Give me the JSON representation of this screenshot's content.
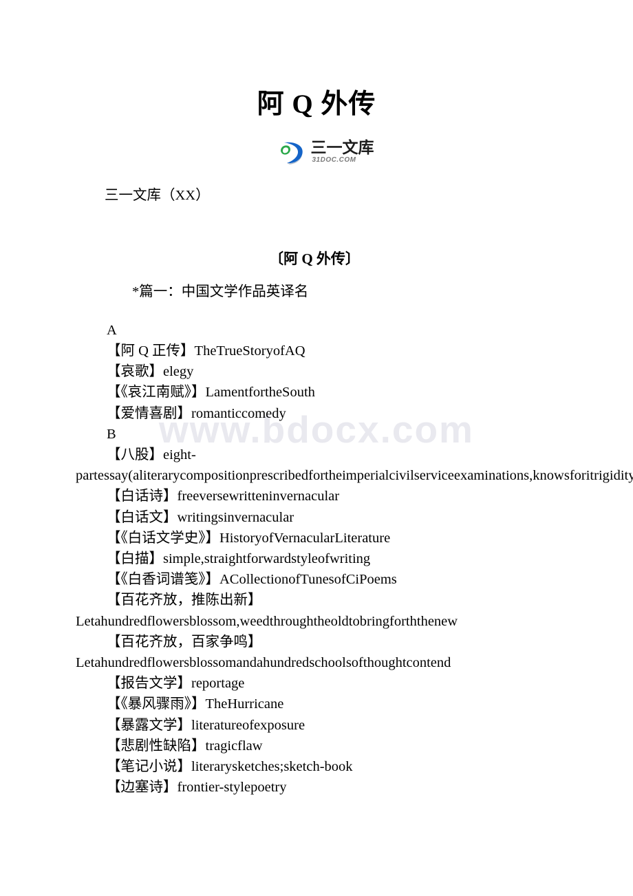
{
  "document": {
    "title": "阿 Q 外传",
    "watermark": "www.bdocx.com",
    "logo": {
      "cn_text": "三一文库",
      "en_text": "31DOC.COM",
      "mark_name": "sanyi-wenku-logo",
      "blue": "#1464c8",
      "blue_dark": "#0d3f96",
      "green": "#2aa84a"
    },
    "site_line": "三一文库（XX）",
    "section_title": "〔阿 Q 外传〕",
    "sub_title": "*篇一：中国文学作品英译名",
    "entries": [
      "A",
      "【阿 Q 正传】TheTrueStoryofAQ",
      "【哀歌】elegy",
      "【《哀江南赋》】LamentfortheSouth",
      "【爱情喜剧】romanticcomedy",
      "B",
      "【八股】eight-partessay(aliterarycompositionprescribedfortheimperialcivilserviceexaminations,knowsforitrigidityofformandpovertyofideas)",
      "【白话诗】freeversewritteninvernacular",
      "【白话文】writingsinvernacular",
      "【《白话文学史》】HistoryofVernacularLiterature",
      "【白描】simple,straightforwardstyleofwriting",
      "【《白香词谱笺》】ACollectionofTunesofCiPoems",
      "【百花齐放，推陈出新】Letahundredflowersblossom,weedthroughtheoldtobringforththenew",
      "【百花齐放，百家争鸣】Letahundredflowersblossomandahundredschoolsofthoughtcontend",
      "【报告文学】reportage",
      "【《暴风骤雨》】TheHurricane",
      "【暴露文学】literatureofexposure",
      "【悲剧性缺陷】tragicflaw",
      "【笔记小说】literarysketches;sketch-book",
      "【边塞诗】frontier-stylepoetry"
    ]
  }
}
